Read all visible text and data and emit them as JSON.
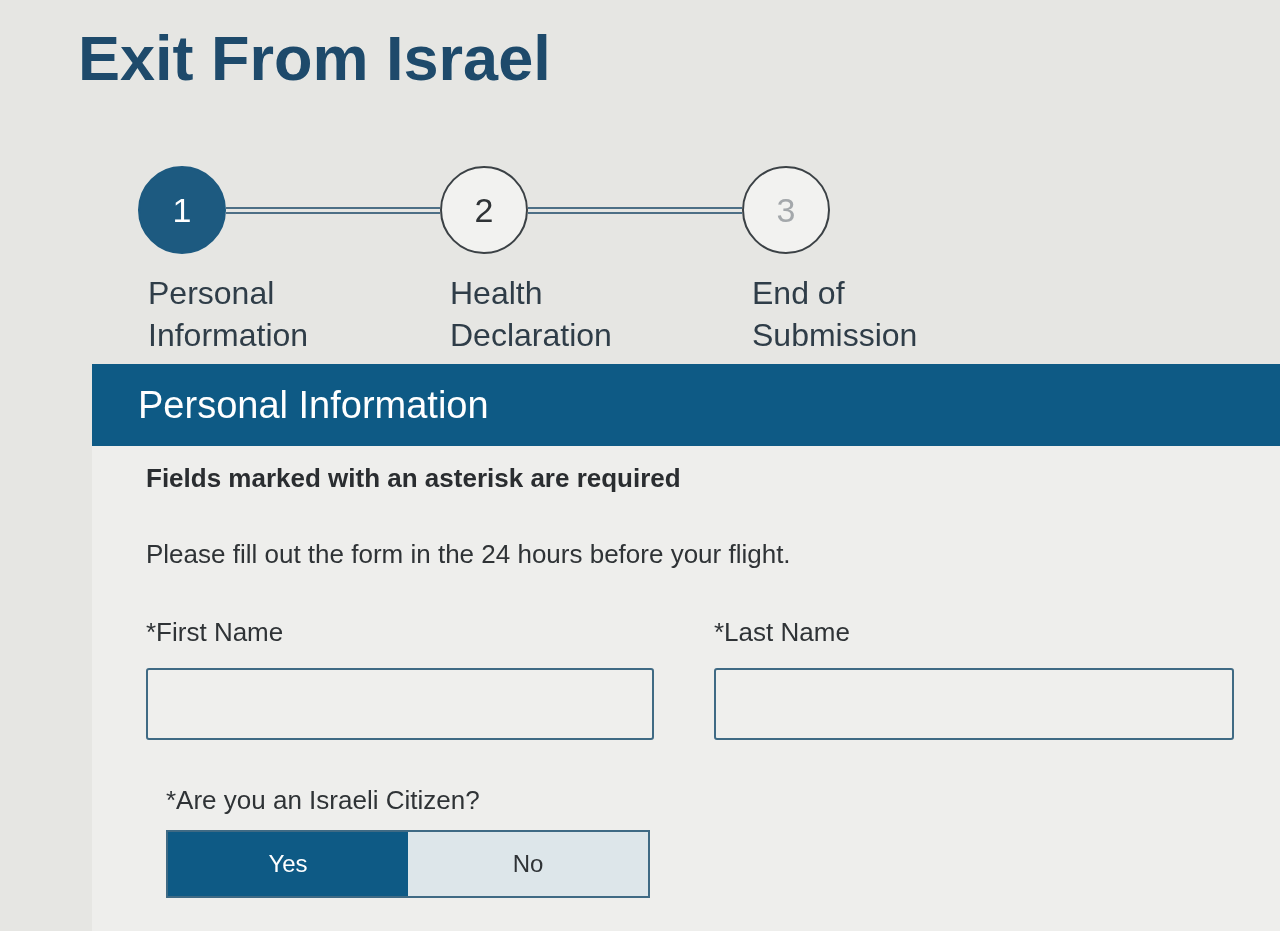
{
  "page_title": "Exit From Israel",
  "steps": [
    {
      "number": "1",
      "label": "Personal Information",
      "selected": true,
      "disabled": false
    },
    {
      "number": "2",
      "label": "Health Declaration",
      "selected": false,
      "disabled": false
    },
    {
      "number": "3",
      "label": "End of Submission",
      "selected": false,
      "disabled": true
    }
  ],
  "section": {
    "title": "Personal Information",
    "required_note": "Fields marked with an asterisk are required",
    "instruction": "Please fill out the form in the 24 hours before your flight.",
    "fields": [
      {
        "label": "*First Name"
      },
      {
        "label": "*Last Name"
      }
    ],
    "citizen_question": {
      "label": "*Are you an Israeli Citizen?",
      "options": [
        {
          "label": "Yes",
          "selected": true
        },
        {
          "label": "No",
          "selected": false
        }
      ]
    }
  }
}
